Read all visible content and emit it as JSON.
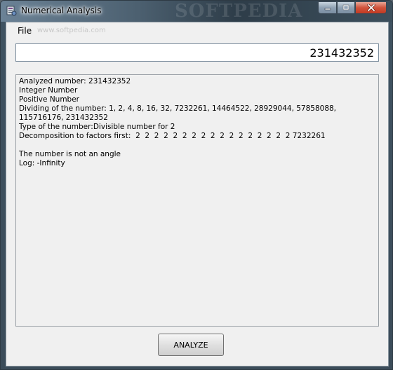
{
  "window": {
    "title": "Numerical Analysis",
    "watermark": "SOFTPEDIA"
  },
  "menu": {
    "file_label": "File",
    "watermark": "www.softpedia.com"
  },
  "input": {
    "value": "231432352"
  },
  "results": [
    "Analyzed number: 231432352",
    "Integer Number",
    "Positive Number",
    "Dividing of the number: 1, 2, 4, 8, 16, 32, 7232261, 14464522, 28929044, 57858088, 115716176, 231432352",
    "Type of the number:Divisible number for 2",
    "Decomposition to factors first:  2  2  2  2  2  2  2  2  2  2  2  2  2  2  2  2  2 7232261",
    "",
    "The number is not an angle",
    "Log: -Infinity"
  ],
  "buttons": {
    "analyze_label": "ANALYZE"
  },
  "colors": {
    "close_button": "#c13a22",
    "client_background": "#f0f0f0"
  }
}
